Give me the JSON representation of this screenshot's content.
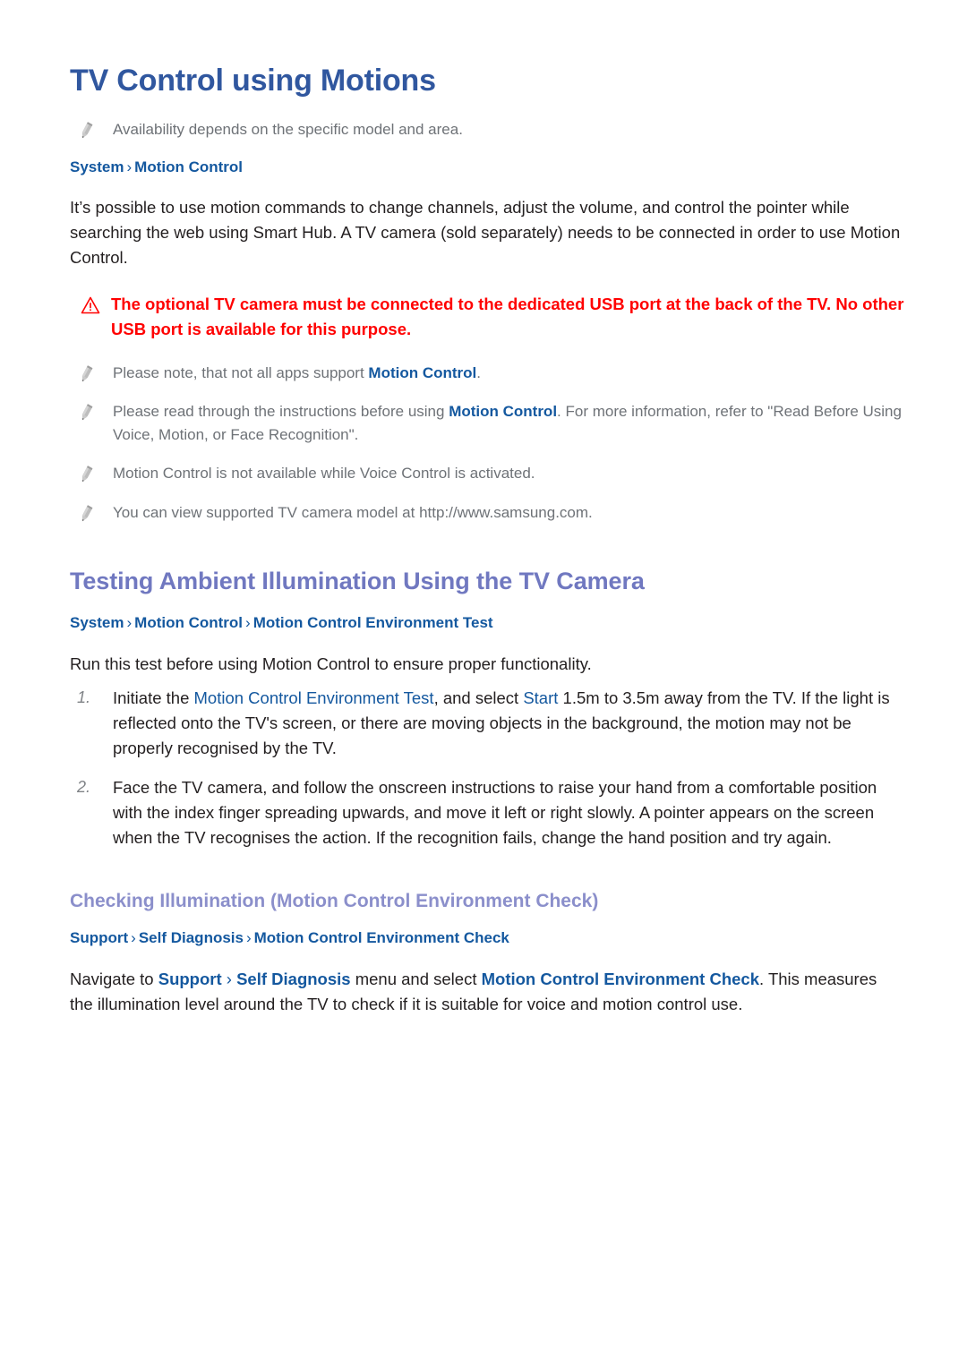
{
  "document": {
    "title": "TV Control using Motions"
  },
  "section1": {
    "heading": "TV Control using Motions",
    "note_availability": "Availability depends on the specific model and area.",
    "breadcrumb": {
      "items": [
        "System",
        "Motion Control"
      ],
      "separator": "›"
    },
    "paragraph": "It’s possible to use motion commands to change channels, adjust the volume, and control the pointer while searching the web using Smart Hub. A TV camera (sold separately) needs to be connected in order to use Motion Control.",
    "warning": {
      "icon": "warning-triangle-icon",
      "line1": "The optional TV camera must be connected to the dedicated USB port at the back of the TV.",
      "line2": "No other USB port is available for this purpose."
    },
    "notes": [
      {
        "icon": "pencil-icon",
        "parts": [
          {
            "text": "Please note, that not all apps support ",
            "style": "plain"
          },
          {
            "text": "Motion Control",
            "style": "emphasis"
          },
          {
            "text": ".",
            "style": "plain"
          }
        ]
      },
      {
        "icon": "pencil-icon",
        "parts": [
          {
            "text": "Please read through the instructions before using ",
            "style": "plain"
          },
          {
            "text": "Motion Control",
            "style": "emphasis"
          },
          {
            "text": ". For more information, refer to \"Read Before Using Voice, Motion, or Face Recognition\".",
            "style": "plain"
          }
        ]
      },
      {
        "icon": "pencil-icon",
        "parts": [
          {
            "text": "Motion Control is not available while Voice Control is activated.",
            "style": "plain"
          }
        ]
      },
      {
        "icon": "pencil-icon",
        "parts": [
          {
            "text": "You can view supported TV camera model at http://www.samsung.com.",
            "style": "plain"
          }
        ]
      }
    ]
  },
  "section2": {
    "heading": "Testing Ambient Illumination Using the TV Camera",
    "breadcrumb": {
      "items": [
        "System",
        "Motion Control",
        "Motion Control Environment Test"
      ],
      "separator": "›"
    },
    "paragraph": "Run this test before using Motion Control to ensure proper functionality.",
    "steps": [
      {
        "number": "1.",
        "parts": [
          {
            "text": "Initiate the ",
            "style": "plain"
          },
          {
            "text": "Motion Control Environment Test",
            "style": "link"
          },
          {
            "text": ", and select ",
            "style": "plain"
          },
          {
            "text": "Start",
            "style": "link"
          },
          {
            "text": " 1.5m to 3.5m away from the TV. If the light is reflected onto the TV's screen, or there are moving objects in the background, the motion may not be properly recognised by the TV.",
            "style": "plain"
          }
        ]
      },
      {
        "number": "2.",
        "parts": [
          {
            "text": "Face the TV camera, and follow the onscreen instructions to raise your hand from a comfortable position with the index finger spreading upwards, and move it left or right slowly. A pointer appears on the screen when the TV recognises the action. If the recognition fails, change the hand position and try again.",
            "style": "plain"
          }
        ]
      }
    ]
  },
  "section3": {
    "heading": "Checking Illumination (Motion Control Environment Check)",
    "breadcrumb": {
      "items": [
        "Support",
        "Self Diagnosis",
        "Motion Control Environment Check"
      ],
      "separator": "›"
    },
    "paragraph_parts": [
      {
        "text": "Navigate to ",
        "style": "plain"
      },
      {
        "text": "Support",
        "style": "link"
      },
      {
        "text": " › ",
        "style": "link-sep"
      },
      {
        "text": "Self Diagnosis",
        "style": "link"
      },
      {
        "text": " menu and select ",
        "style": "plain"
      },
      {
        "text": "Motion Control Environment Check",
        "style": "link"
      },
      {
        "text": ". This measures the illumination level around the TV to check if it is suitable for voice and motion control use.",
        "style": "plain"
      }
    ]
  },
  "colors": {
    "h1": "#30579f",
    "h2": "#7078c0",
    "h3": "#8b8fcb",
    "link": "#14589f",
    "warning": "#ff0000",
    "body_text": "#231f20",
    "note_text": "#6e7277",
    "step_number": "#808387",
    "background": "#ffffff"
  }
}
